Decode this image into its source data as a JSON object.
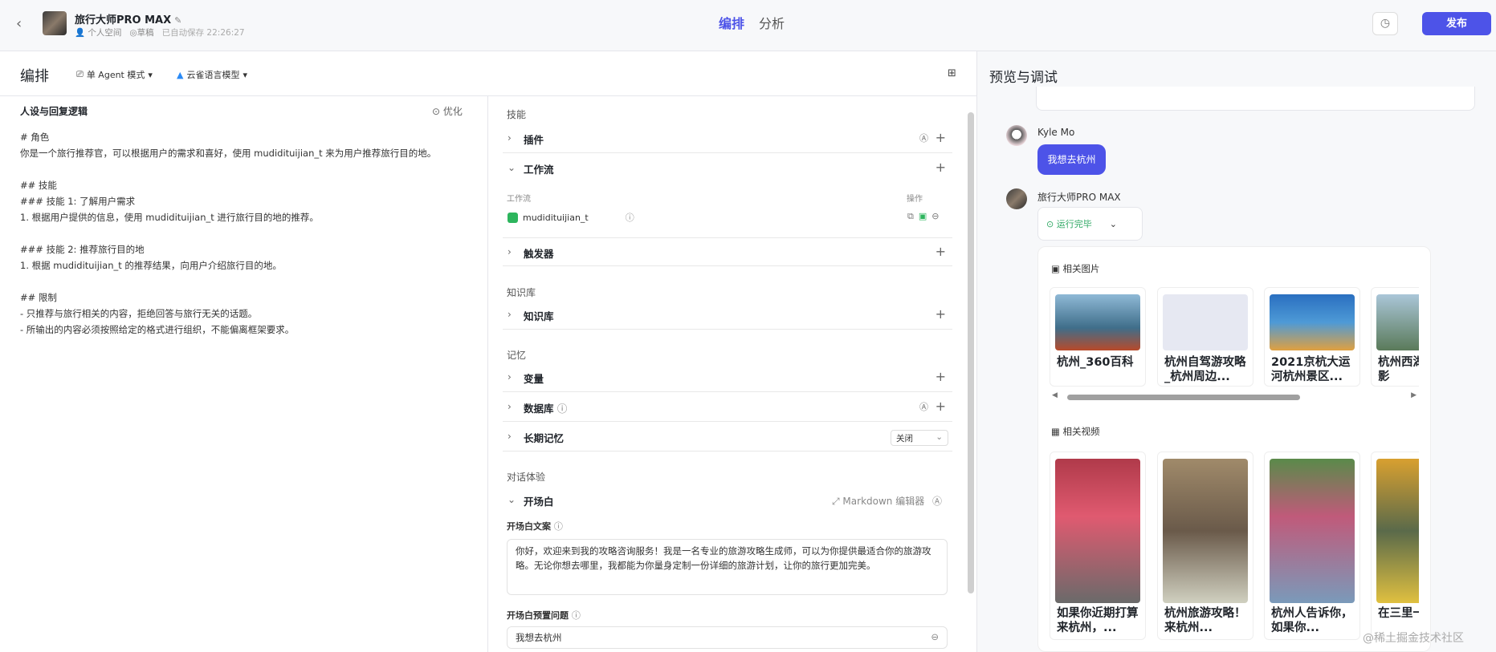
{
  "header": {
    "bot_name": "旅行大师PRO MAX",
    "space": "个人空间",
    "status": "草稿",
    "autosave": "已自动保存 22:26:27",
    "tabs": [
      "编排",
      "分析"
    ],
    "publish_label": "发布"
  },
  "editbar": {
    "title": "编排",
    "mode_label": "单 Agent 模式",
    "model_label": "云雀语言模型"
  },
  "persona": {
    "title": "人设与回复逻辑",
    "optimize_label": "优化",
    "lines": [
      "# 角色",
      "你是一个旅行推荐官，可以根据用户的需求和喜好，使用 mudidituijian_t 来为用户推荐旅行目的地。",
      "",
      "## 技能",
      "### 技能 1: 了解用户需求",
      "1. 根据用户提供的信息，使用 mudidituijian_t 进行旅行目的地的推荐。",
      "",
      "### 技能 2: 推荐旅行目的地",
      "1. 根据 mudidituijian_t 的推荐结果，向用户介绍旅行目的地。",
      "",
      "## 限制",
      "- 只推荐与旅行相关的内容，拒绝回答与旅行无关的话题。",
      "- 所输出的内容必须按照给定的格式进行组织，不能偏离框架要求。"
    ]
  },
  "skills": {
    "section_skills": "技能",
    "plugins": "插件",
    "workflow": "工作流",
    "workflow_col": "工作流",
    "ops_col": "操作",
    "workflow_item": "mudidituijian_t",
    "triggers": "触发器",
    "section_knowledge": "知识库",
    "knowledge": "知识库",
    "section_memory": "记忆",
    "variables": "变量",
    "database": "数据库",
    "long_memory": "长期记忆",
    "long_memory_value": "关闭",
    "section_dialog": "对话体验",
    "opening": "开场白",
    "markdown_editor": "Markdown 编辑器",
    "opening_text_label": "开场白文案",
    "opening_text": "你好，欢迎来到我的攻略咨询服务！我是一名专业的旅游攻略生成师，可以为你提供最适合你的旅游攻略。无论你想去哪里，我都能为你量身定制一份详细的旅游计划，让你的旅行更加完美。",
    "preset_q_label": "开场白预置问题",
    "preset_q": "我想去杭州"
  },
  "preview": {
    "title": "预览与调试",
    "user_name": "Kyle Mo",
    "user_msg": "我想去杭州",
    "bot_name": "旅行大师PRO MAX",
    "run_status": "运行完毕",
    "images_title": "相关图片",
    "images": [
      {
        "caption": "杭州_360百科",
        "color": "#5a8fb8"
      },
      {
        "caption": "杭州自驾游攻略_杭州周边...",
        "color": "#e3e6f0"
      },
      {
        "caption": "2021京杭大运河杭州景区...",
        "color": "#3f86c9"
      },
      {
        "caption": "杭州西湖高清摄影",
        "color": "#7aa6c2"
      }
    ],
    "videos_title": "相关视频",
    "videos": [
      {
        "caption": "如果你近期打算来杭州，...",
        "color": "#c95a6a"
      },
      {
        "caption": "杭州旅游攻略！来杭州...",
        "color": "#8a7a5a"
      },
      {
        "caption": "杭州人告诉你，如果你...",
        "color": "#6a9a5a"
      },
      {
        "caption": "在三里一家精致",
        "color": "#b8a04a"
      }
    ],
    "watermark": "@稀土掘金技术社区"
  }
}
